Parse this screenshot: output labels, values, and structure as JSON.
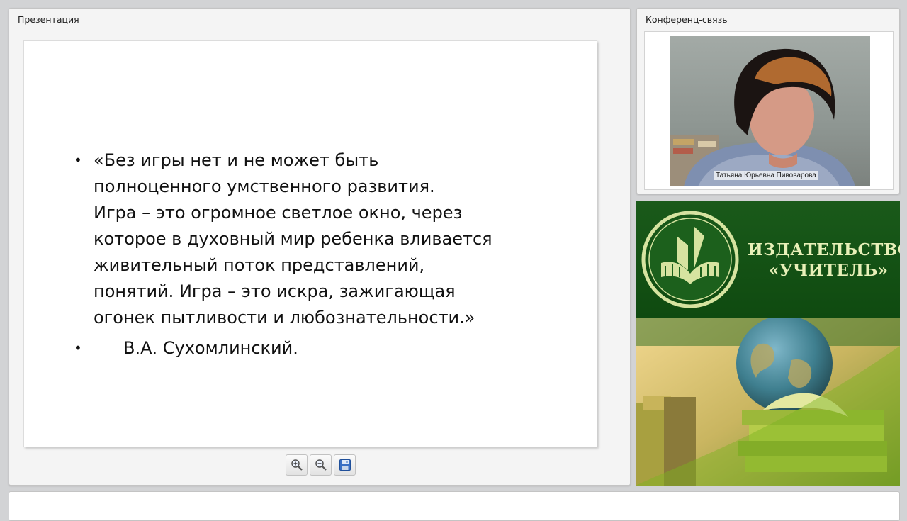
{
  "presentation": {
    "title": "Презентация",
    "slide": {
      "quote_lines": [
        "«Без игры нет и не может быть",
        "полноценного умственного развития.",
        "Игра – это огромное светлое окно, через",
        "которое в духовный мир ребенка вливается",
        "живительный поток представлений,",
        "понятий. Игра – это искра, зажигающая",
        "огонек пытливости и любознательности.»"
      ],
      "author": "В.А. Сухомлинский.",
      "bullet": "•"
    },
    "toolbar": {
      "zoom_in_icon": "zoom-in-icon",
      "zoom_out_icon": "zoom-out-icon",
      "save_icon": "floppy-disk-icon"
    }
  },
  "conference": {
    "title": "Конференц-связь",
    "participant_name": "Татьяна Юрьевна Пивоварова"
  },
  "banner": {
    "line1": "ИЗДАТЕЛЬСТВО",
    "line2": "«УЧИТЕЛЬ»",
    "colors": {
      "green": "#1a5a1a",
      "lime": "#c8d84a"
    }
  }
}
